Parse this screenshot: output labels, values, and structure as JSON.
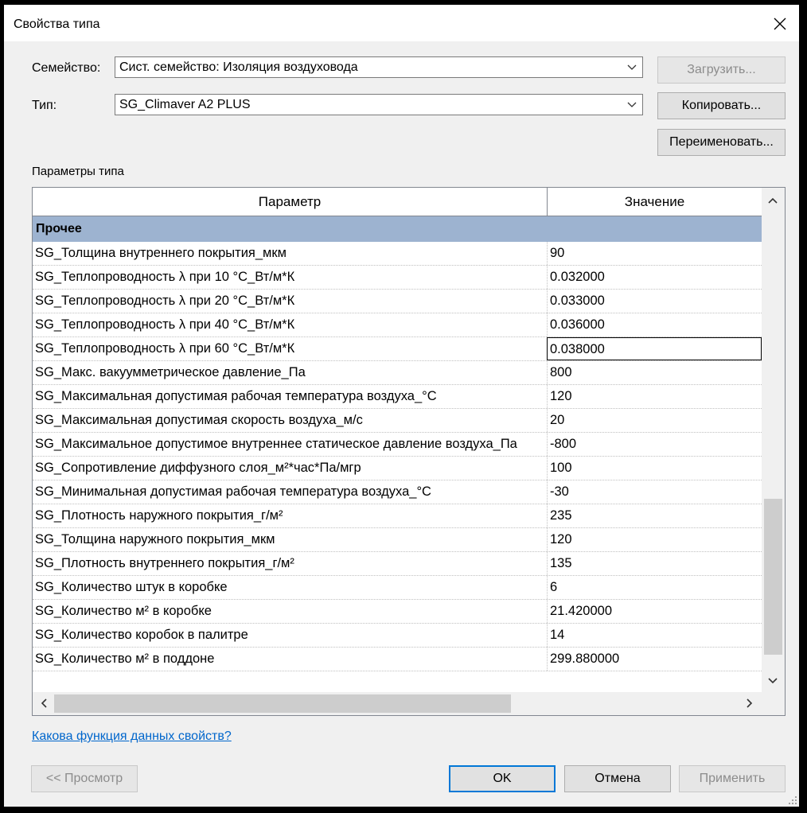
{
  "dialog": {
    "title": "Свойства типа",
    "close_icon": "close-icon"
  },
  "family": {
    "label": "Семейство:",
    "value": "Сист. семейство: Изоляция воздуховода"
  },
  "type": {
    "label": "Тип:",
    "value": "SG_Climaver A2 PLUS"
  },
  "buttons": {
    "load": "Загрузить...",
    "copy": "Копировать...",
    "rename": "Переименовать...",
    "preview": "<< Просмотр",
    "ok": "OK",
    "cancel": "Отмена",
    "apply": "Применить"
  },
  "section_label": "Параметры типа",
  "grid": {
    "col_param": "Параметр",
    "col_value": "Значение",
    "group": "Прочее",
    "rows": [
      {
        "p": "SG_Толщина внутреннего покрытия_мкм",
        "v": "90"
      },
      {
        "p": "SG_Теплопроводность λ при 10 °С_Вт/м*К",
        "v": "0.032000"
      },
      {
        "p": "SG_Теплопроводность λ при 20 °С_Вт/м*К",
        "v": "0.033000"
      },
      {
        "p": "SG_Теплопроводность λ при 40 °С_Вт/м*К",
        "v": "0.036000"
      },
      {
        "p": "SG_Теплопроводность λ при 60 °С_Вт/м*К",
        "v": "0.038000"
      },
      {
        "p": "SG_Макс. вакуумметрическое давление_Па",
        "v": "800"
      },
      {
        "p": "SG_Максимальная допустимая рабочая температура воздуха_°С",
        "v": "120"
      },
      {
        "p": "SG_Максимальная допустимая скорость воздуха_м/с",
        "v": "20"
      },
      {
        "p": "SG_Максимальное допустимое внутреннее статическое давление воздуха_Па",
        "v": "-800"
      },
      {
        "p": "SG_Сопротивление диффузного слоя_м²*час*Па/мгр",
        "v": "100"
      },
      {
        "p": "SG_Минимальная допустимая рабочая температура воздуха_°С",
        "v": "-30"
      },
      {
        "p": "SG_Плотность наружного покрытия_г/м²",
        "v": "235"
      },
      {
        "p": "SG_Толщина наружного покрытия_мкм",
        "v": "120"
      },
      {
        "p": "SG_Плотность внутреннего покрытия_г/м²",
        "v": "135"
      },
      {
        "p": "SG_Количество штук в коробке",
        "v": "6"
      },
      {
        "p": "SG_Количество м² в коробке",
        "v": "21.420000"
      },
      {
        "p": "SG_Количество коробок в палитре",
        "v": "14"
      },
      {
        "p": "SG_Количество м² в поддоне",
        "v": "299.880000"
      }
    ]
  },
  "help_link": "Какова функция данных свойств?"
}
